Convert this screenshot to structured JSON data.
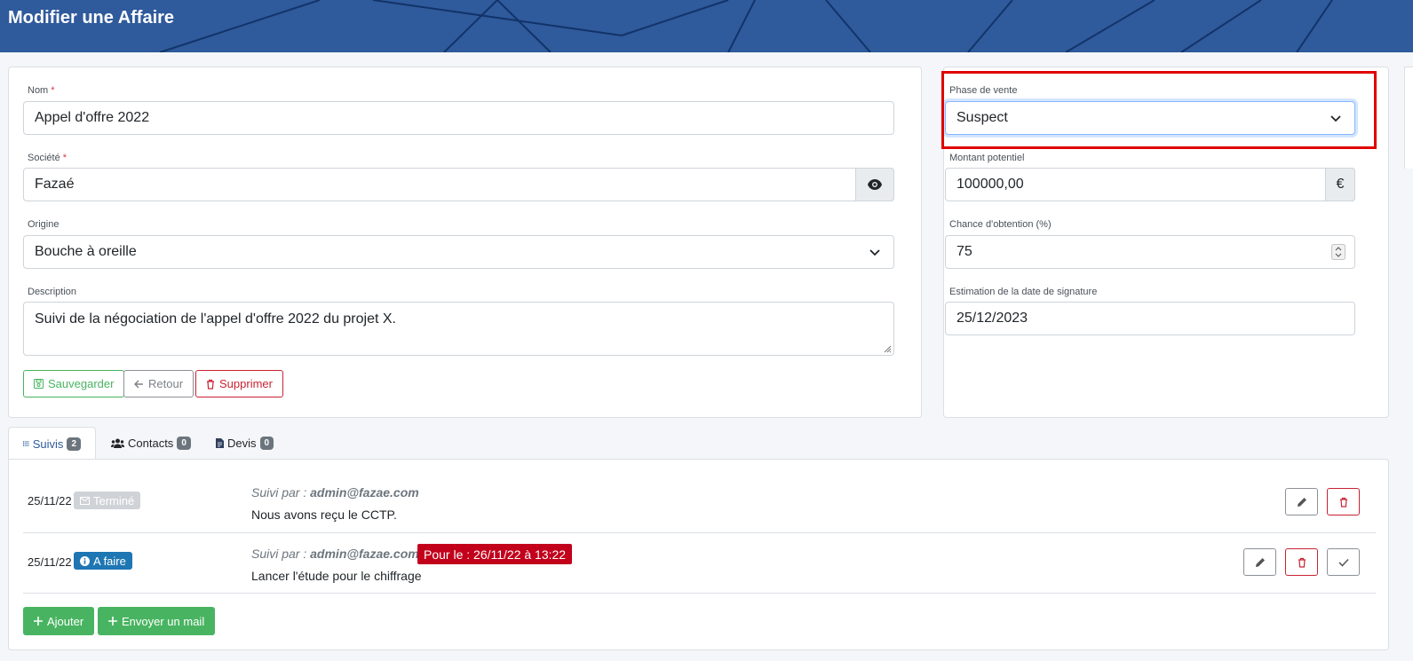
{
  "header": {
    "title": "Modifier une Affaire"
  },
  "form": {
    "nom": {
      "label": "Nom",
      "required": "*",
      "value": "Appel d'offre 2022"
    },
    "societe": {
      "label": "Société",
      "required": "*",
      "value": "Fazaé"
    },
    "origine": {
      "label": "Origine",
      "value": "Bouche à oreille"
    },
    "description": {
      "label": "Description",
      "value": "Suivi de la négociation de l'appel d'offre 2022 du projet X."
    },
    "buttons": {
      "save": "Sauvegarder",
      "back": "Retour",
      "delete": "Supprimer"
    }
  },
  "side": {
    "phase": {
      "label": "Phase de vente",
      "value": "Suspect"
    },
    "montant": {
      "label": "Montant potentiel",
      "value": "100000,00",
      "unit": "€"
    },
    "chance": {
      "label": "Chance d'obtention (%)",
      "value": "75"
    },
    "date": {
      "label": "Estimation de la date de signature",
      "value": "25/12/2023"
    }
  },
  "tabs": [
    {
      "label": "Suivis",
      "count": "2"
    },
    {
      "label": "Contacts",
      "count": "0"
    },
    {
      "label": "Devis",
      "count": "0"
    }
  ],
  "suivis": [
    {
      "date": "25/11/22",
      "status": "Terminé",
      "by_prefix": "Suivi par :",
      "by": "admin@fazae.com",
      "text": "Nous avons reçu le CCTP."
    },
    {
      "date": "25/11/22",
      "status": "A faire",
      "by_prefix": "Suivi par :",
      "by": "admin@fazae.com",
      "due": "Pour le : 26/11/22 à 13:22",
      "text": "Lancer l'étude pour le chiffrage"
    }
  ],
  "actions": {
    "add": "Ajouter",
    "mail": "Envoyer un mail"
  },
  "colors": {
    "header": "#2f5a9c",
    "success": "#48b461",
    "danger": "#c82333",
    "info": "#1e76b3",
    "highlight": "#e00000"
  }
}
